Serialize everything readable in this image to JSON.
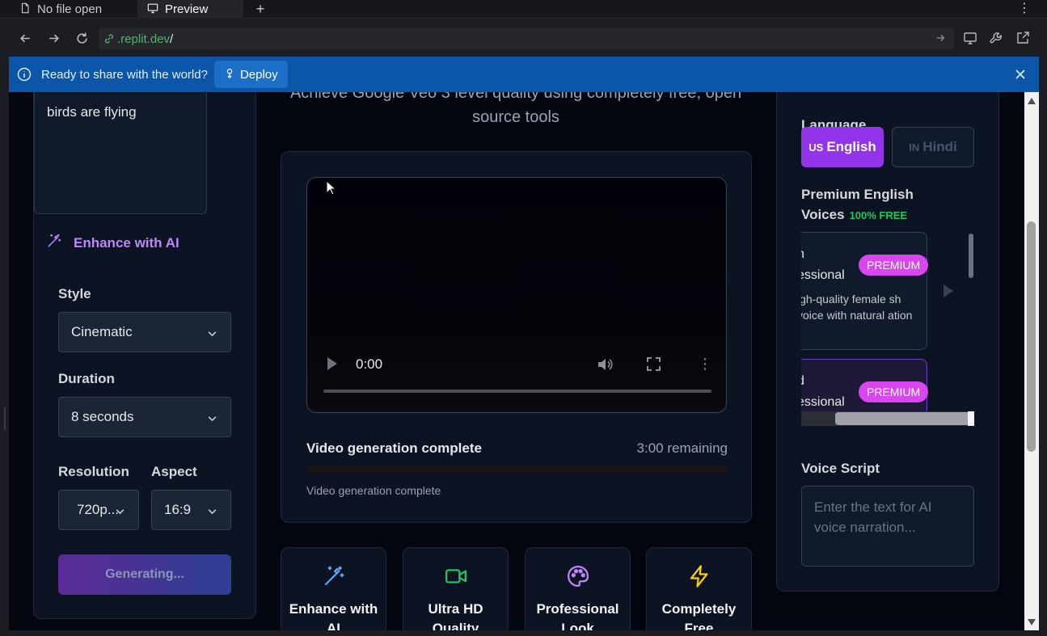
{
  "browser": {
    "tabs": [
      {
        "label": "No file open",
        "icon": "file-icon"
      },
      {
        "label": "Preview",
        "icon": "monitor-icon"
      }
    ],
    "new_tab": "+",
    "url_domain": ".replit.dev",
    "url_path": "/"
  },
  "banner": {
    "message": "Ready to share with the world?",
    "deploy_label": "Deploy"
  },
  "left": {
    "prompt_text": "birds are flying",
    "enhance_label": "Enhance with AI",
    "style_label": "Style",
    "style_value": "Cinematic",
    "duration_label": "Duration",
    "duration_value": "8 seconds",
    "resolution_label": "Resolution",
    "resolution_value": "720p...",
    "aspect_label": "Aspect",
    "aspect_value": "16:9",
    "generate_label": "Generating..."
  },
  "center": {
    "subtitle": "Achieve Google Veo 3 level quality using completely free, open source tools",
    "player_time": "0:00",
    "playback_fraction": 0,
    "status_title": "Video generation complete",
    "status_remaining": "3:00 remaining",
    "progress_fraction": 0.0,
    "status_sub": "Video generation complete",
    "features": [
      {
        "label": "Enhance with AI",
        "icon": "magic-wand-icon",
        "color": "#60a5fa"
      },
      {
        "label": "Ultra HD Quality",
        "icon": "video-camera-icon",
        "color": "#22c55e"
      },
      {
        "label": "Professional Look",
        "icon": "palette-icon",
        "color": "#c084fc"
      },
      {
        "label": "Completely Free",
        "icon": "lightning-icon",
        "color": "#facc15"
      }
    ]
  },
  "right": {
    "language_label": "Language",
    "lang_en_code": "US",
    "lang_en": "English",
    "lang_hi_code": "IN",
    "lang_hi": "Hindi",
    "voices_label": "Premium English Voices",
    "free_badge": "100% FREE",
    "voices": [
      {
        "name_line1": "h",
        "name_line2": "essional",
        "badge": "PREMIUM",
        "desc": "igh-quality female sh voice with natural ation"
      },
      {
        "name_line1": "d",
        "name_line2": "essional",
        "badge": "PREMIUM",
        "desc": ""
      }
    ],
    "script_label": "Voice Script",
    "script_placeholder": "Enter the text for AI voice narration..."
  },
  "colors": {
    "accent_purple": "#9333ea",
    "premium_pink": "#d946ef",
    "banner_blue": "#0b56a8",
    "link_green": "#56b36b"
  }
}
